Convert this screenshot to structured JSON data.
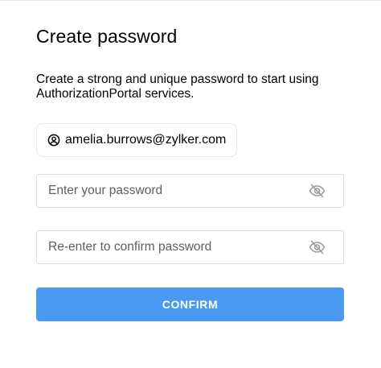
{
  "page": {
    "title": "Create password",
    "description": "Create a strong and unique password to start using AuthorizationPortal services."
  },
  "account": {
    "email": "amelia.burrows@zylker.com",
    "icon": "user-circle-icon"
  },
  "password_field": {
    "value": "",
    "placeholder": "Enter your password",
    "toggle_icon": "eye-off-icon"
  },
  "confirm_field": {
    "value": "",
    "placeholder": "Re-enter to confirm password",
    "toggle_icon": "eye-off-icon"
  },
  "confirm_button": {
    "label": "CONFIRM"
  },
  "colors": {
    "accent": "#4a9af4",
    "icon": "#9a9a9a",
    "border": "#dcdcdc"
  }
}
